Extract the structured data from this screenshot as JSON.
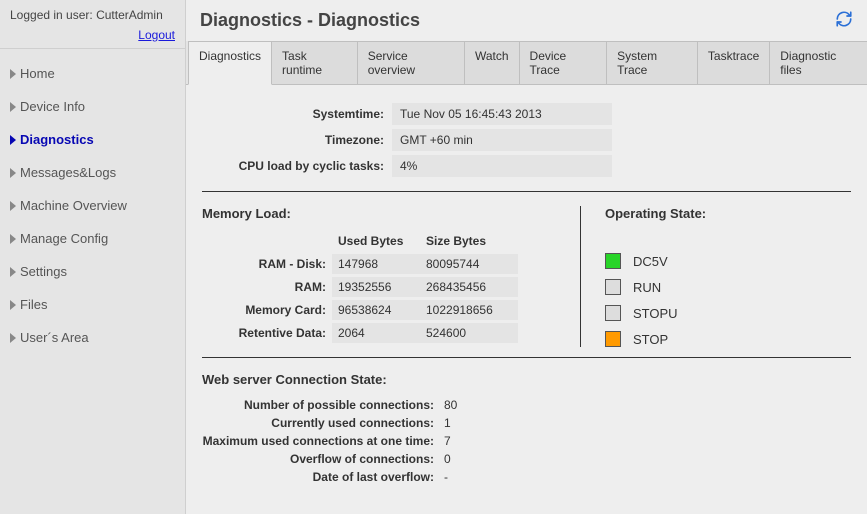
{
  "user": {
    "logged_in_prefix": "Logged in user: ",
    "username": "CutterAdmin",
    "logout_label": "Logout"
  },
  "nav": {
    "items": [
      {
        "label": "Home",
        "active": false
      },
      {
        "label": "Device Info",
        "active": false
      },
      {
        "label": "Diagnostics",
        "active": true
      },
      {
        "label": "Messages&Logs",
        "active": false
      },
      {
        "label": "Machine Overview",
        "active": false
      },
      {
        "label": "Manage Config",
        "active": false
      },
      {
        "label": "Settings",
        "active": false
      },
      {
        "label": "Files",
        "active": false
      },
      {
        "label": "User´s Area",
        "active": false
      }
    ]
  },
  "header": {
    "title": "Diagnostics - Diagnostics"
  },
  "tabs": [
    {
      "label": "Diagnostics",
      "active": true
    },
    {
      "label": "Task runtime",
      "active": false
    },
    {
      "label": "Service overview",
      "active": false
    },
    {
      "label": "Watch",
      "active": false
    },
    {
      "label": "Device Trace",
      "active": false
    },
    {
      "label": "System Trace",
      "active": false
    },
    {
      "label": "Tasktrace",
      "active": false
    },
    {
      "label": "Diagnostic files",
      "active": false
    }
  ],
  "sysinfo": {
    "systemtime_label": "Systemtime:",
    "systemtime_value": "Tue Nov 05 16:45:43 2013",
    "timezone_label": "Timezone:",
    "timezone_value": "GMT +60 min",
    "cpuload_label": "CPU load by cyclic tasks:",
    "cpuload_value": "4%"
  },
  "memory": {
    "title": "Memory Load:",
    "col_used": "Used Bytes",
    "col_size": "Size Bytes",
    "rows": [
      {
        "label": "RAM - Disk:",
        "used": "147968",
        "size": "80095744"
      },
      {
        "label": "RAM:",
        "used": "19352556",
        "size": "268435456"
      },
      {
        "label": "Memory Card:",
        "used": "96538624",
        "size": "1022918656"
      },
      {
        "label": "Retentive Data:",
        "used": "2064",
        "size": "524600"
      }
    ]
  },
  "operating_state": {
    "title": "Operating State:",
    "items": [
      {
        "label": "DC5V",
        "color": "green"
      },
      {
        "label": "RUN",
        "color": "grey"
      },
      {
        "label": "STOPU",
        "color": "grey"
      },
      {
        "label": "STOP",
        "color": "orange"
      }
    ]
  },
  "webserver": {
    "title": "Web server Connection State:",
    "rows": [
      {
        "label": "Number of possible connections:",
        "value": "80"
      },
      {
        "label": "Currently used connections:",
        "value": "1"
      },
      {
        "label": "Maximum used connections at one time:",
        "value": "7"
      },
      {
        "label": "Overflow of connections:",
        "value": "0"
      },
      {
        "label": "Date of last overflow:",
        "value": "-"
      }
    ]
  }
}
